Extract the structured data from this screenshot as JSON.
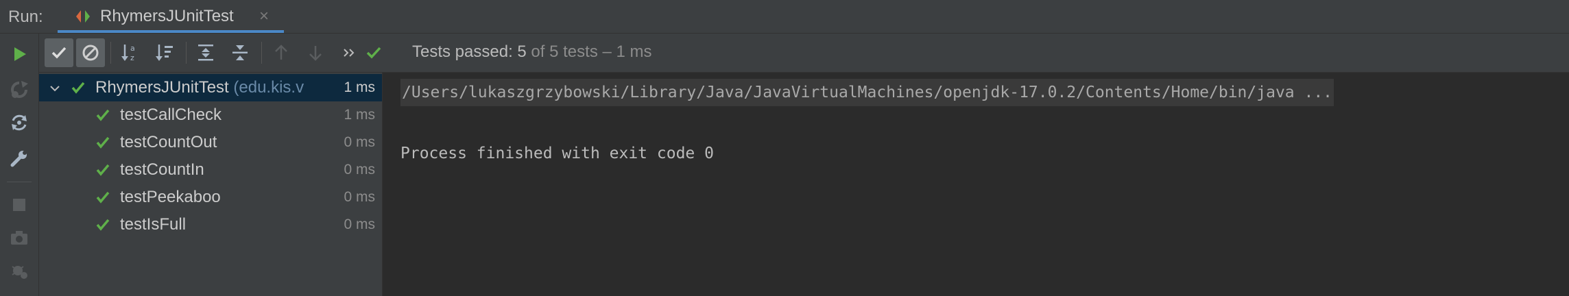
{
  "tabbar": {
    "run_label": "Run:",
    "tab_title": "RhymersJUnitTest",
    "tab_close": "×"
  },
  "lefttools": [
    "run-icon",
    "rerun-failed-icon",
    "toggle-auto-test-icon",
    "wrench-icon",
    "stop-icon",
    "camera-icon",
    "debug-settings-icon"
  ],
  "testbar": {
    "status_passed": "Tests passed: 5",
    "status_of": " of 5 tests – 1 ms",
    "buttons": [
      "show-passed",
      "show-ignored",
      "sort-alphabetically",
      "sort-by-duration",
      "expand-all",
      "collapse-all",
      "previous-failed",
      "next-failed",
      "more"
    ]
  },
  "tree": {
    "root": {
      "name": "RhymersJUnitTest",
      "pkg": " (edu.kis.v",
      "time": "1 ms"
    },
    "items": [
      {
        "name": "testCallCheck",
        "time": "1 ms"
      },
      {
        "name": "testCountOut",
        "time": "0 ms"
      },
      {
        "name": "testCountIn",
        "time": "0 ms"
      },
      {
        "name": "testPeekaboo",
        "time": "0 ms"
      },
      {
        "name": "testIsFull",
        "time": "0 ms"
      }
    ]
  },
  "console": {
    "command": "/Users/lukaszgrzybowski/Library/Java/JavaVirtualMachines/openjdk-17.0.2/Contents/Home/bin/java ...",
    "exit_message": "Process finished with exit code 0"
  },
  "colors": {
    "pass_green": "#5fb04a",
    "selection": "#0d293e",
    "tab_accent": "#4a88c7"
  }
}
